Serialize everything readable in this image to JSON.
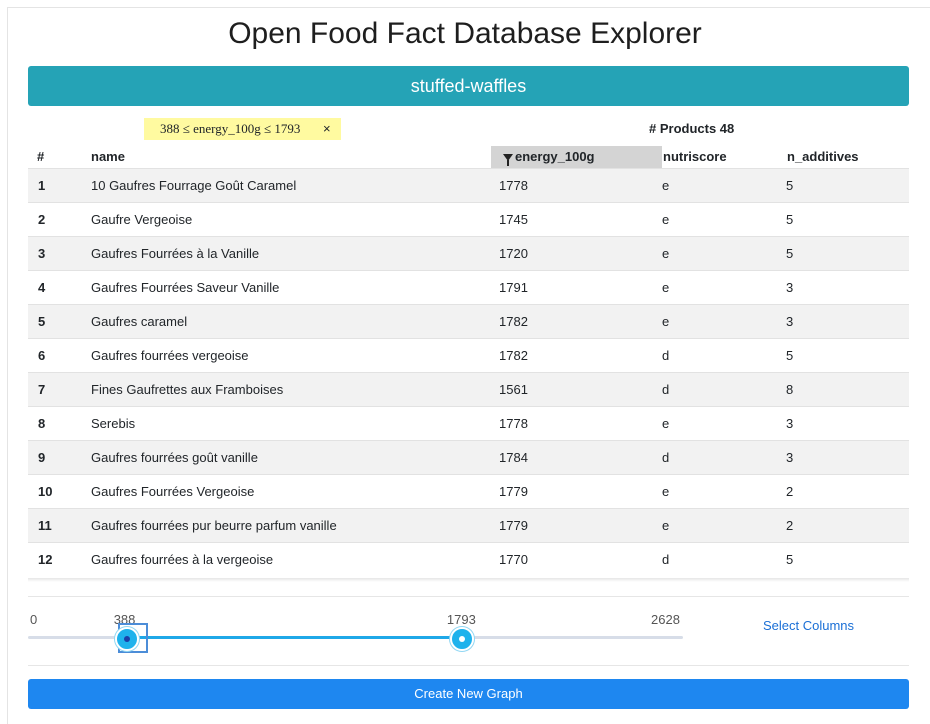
{
  "app_title": "Open Food Fact Database Explorer",
  "category": "stuffed-waffles",
  "filter": {
    "label": "388 ≤ energy_100g ≤ 1793",
    "close": "×"
  },
  "products_count": "# Products 48",
  "columns": {
    "index": "#",
    "name": "name",
    "energy": "energy_100g",
    "nutriscore": "nutriscore",
    "additives": "n_additives"
  },
  "rows": [
    {
      "idx": "1",
      "name": "10 Gaufres Fourrage Goût Caramel",
      "energy": "1778",
      "nutriscore": "e",
      "additives": "5"
    },
    {
      "idx": "2",
      "name": "Gaufre Vergeoise",
      "energy": "1745",
      "nutriscore": "e",
      "additives": "5"
    },
    {
      "idx": "3",
      "name": "Gaufres Fourrées à la Vanille",
      "energy": "1720",
      "nutriscore": "e",
      "additives": "5"
    },
    {
      "idx": "4",
      "name": "Gaufres Fourrées Saveur Vanille",
      "energy": "1791",
      "nutriscore": "e",
      "additives": "3"
    },
    {
      "idx": "5",
      "name": "Gaufres caramel",
      "energy": "1782",
      "nutriscore": "e",
      "additives": "3"
    },
    {
      "idx": "6",
      "name": "Gaufres fourrées vergeoise",
      "energy": "1782",
      "nutriscore": "d",
      "additives": "5"
    },
    {
      "idx": "7",
      "name": "Fines Gaufrettes aux Framboises",
      "energy": "1561",
      "nutriscore": "d",
      "additives": "8"
    },
    {
      "idx": "8",
      "name": "Serebis",
      "energy": "1778",
      "nutriscore": "e",
      "additives": "3"
    },
    {
      "idx": "9",
      "name": "Gaufres fourrées goût vanille",
      "energy": "1784",
      "nutriscore": "d",
      "additives": "3"
    },
    {
      "idx": "10",
      "name": "Gaufres Fourrées Vergeoise",
      "energy": "1779",
      "nutriscore": "e",
      "additives": "2"
    },
    {
      "idx": "11",
      "name": "Gaufres fourrées pur beurre parfum vanille",
      "energy": "1779",
      "nutriscore": "e",
      "additives": "2"
    },
    {
      "idx": "12",
      "name": "Gaufres fourrées à la vergeoise",
      "energy": "1770",
      "nutriscore": "d",
      "additives": "5"
    }
  ],
  "slider": {
    "min": 0,
    "max": 2628,
    "low": 388,
    "high": 1793,
    "min_label": "0",
    "max_label": "2628",
    "low_label": "388",
    "high_label": "1793"
  },
  "select_columns_label": "Select Columns",
  "create_graph_label": "Create New Graph",
  "colors": {
    "category_bar": "#25a3b6",
    "filter_chip": "#fffaa0",
    "slider_fill": "#1fa8e8",
    "button": "#1e87f0",
    "link": "#1a6fd6"
  }
}
